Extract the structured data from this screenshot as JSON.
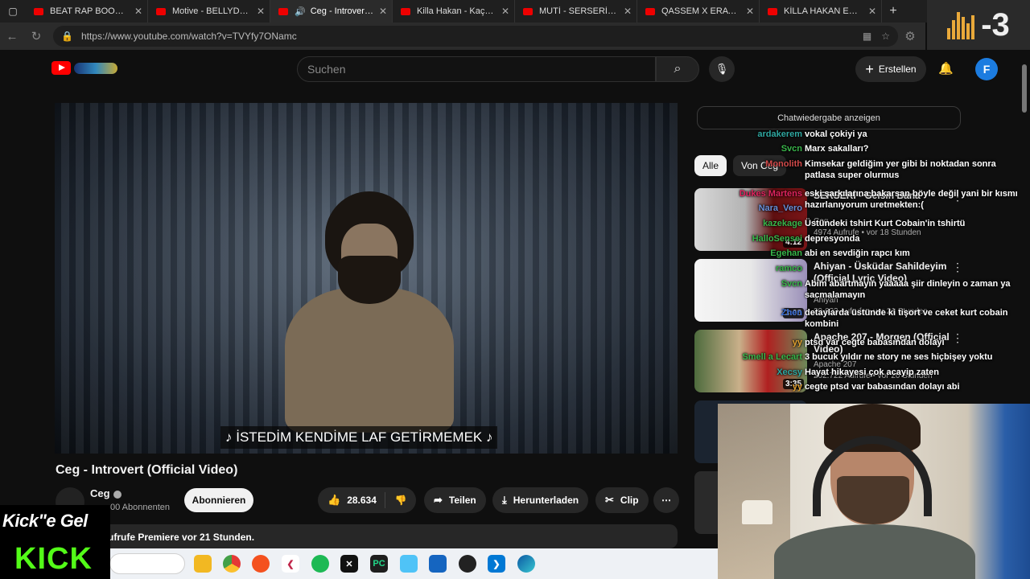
{
  "browser": {
    "tabs": [
      {
        "title": "BEAT RAP BOOM BAP",
        "active": false
      },
      {
        "title": "Motive - BELLYDANCE",
        "active": false
      },
      {
        "title": "Ceg - Introvert (O",
        "active": true
      },
      {
        "title": "Killa Hakan - Kaçan Ku",
        "active": false
      },
      {
        "title": "MUTİ - SERSERİ GÜNL",
        "active": false
      },
      {
        "title": "QASSEM X ERAY067 &",
        "active": false
      },
      {
        "title": "KİLLA HAKAN EV ZİYAR",
        "active": false
      }
    ],
    "url": "https://www.youtube.com/watch?v=TVYfy7ONamc"
  },
  "overlay_counter": "-3",
  "youtube": {
    "search_placeholder": "Suchen",
    "create_label": "Erstellen",
    "avatar_letter": "F",
    "video": {
      "subtitle": "♪ İSTEDİM KENDİME LAF GETİRMEMEK ♪",
      "title": "Ceg - Introvert (Official Video)",
      "channel": "Ceg",
      "subscribers": "00 Abonnenten",
      "subscribe_label": "Abonnieren",
      "likes": "28.634",
      "share_label": "Teilen",
      "download_label": "Herunterladen",
      "clip_label": "Clip",
      "description": "ufrufe  Premiere vor 21 Stunden."
    },
    "chat_header": "Chatwiedergabe anzeigen",
    "chips": [
      "Alle",
      "Von Ceg"
    ],
    "recommendations": [
      {
        "title": "SERSERİ - Gelsin Bana",
        "channel": "Ceg",
        "stats": "4974 Aufrufe • vor 18 Stunden",
        "badge": "Neu",
        "duration": "4:12"
      },
      {
        "title": "Ahiyan - Üsküdar Sahildeyim (Official Lyric Video)",
        "channel": "Ahiyan",
        "stats": "29.623 Aufrufe • vor 21 Stunden",
        "badge": "Neu",
        "duration": "3:08"
      },
      {
        "title": "Apache 207 - Morgen (Official Video)",
        "channel": "Apache 207",
        "stats": "202.722 Aufrufe • vor 20 Stunden",
        "badge": "",
        "duration": "3:35"
      }
    ]
  },
  "chat_messages": [
    {
      "user": "ardakerem",
      "text": "vokal çokiyi ya",
      "color": "#2fa7a0"
    },
    {
      "user": "Svcn",
      "text": "Marx sakalları?",
      "color": "#39b54a"
    },
    {
      "user": "Monolith",
      "text": "Kimsekar geldiğim yer gibi bi noktadan sonra patlasa super olurmus",
      "color": "#d24a4a"
    },
    {
      "user": "Dukes Martens",
      "text": "eski şarkılarına bakarsan böyle değil yani bir kısmı hazırlanıyorum uretmekten:(",
      "color": "#e0245e"
    },
    {
      "user": "Nara_Vero",
      "text": "",
      "color": "#6a8fd8"
    },
    {
      "user": "kazekage",
      "text": "Üstündeki tshirt Kurt Cobain'in tshirtü",
      "color": "#39b54a"
    },
    {
      "user": "HalloSensei",
      "text": "depresyonda",
      "color": "#39b54a"
    },
    {
      "user": "Egehan",
      "text": "abi en sevdiğin rapcı kım",
      "color": "#39b54a"
    },
    {
      "user": "ramco",
      "text": "",
      "color": "#39b54a"
    },
    {
      "user": "Svcn",
      "text": "Abim abartmayın yaaaaa şiir dinleyin o zaman ya sacmalamayın",
      "color": "#39b54a"
    },
    {
      "user": "Zhen",
      "text": "detaylarda üstünde ki tişort ve ceket kurt cobain kombini",
      "color": "#3b6fd8"
    },
    {
      "user": "yy",
      "text": "ptsd var cegte babasından dolayı",
      "color": "#e0a030"
    },
    {
      "user": "Smell a Lecart",
      "text": "3 bucuk yıldır ne story ne ses hiçbişey yoktu",
      "color": "#39b54a"
    },
    {
      "user": "Xecsy",
      "text": "Hayat hikayesi çok acayip zaten",
      "color": "#2fa7a0"
    },
    {
      "user": "yy",
      "text": "cegte ptsd var babasından dolayı abi",
      "color": "#e0a030"
    }
  ],
  "kick": {
    "line1": "Kick\"e Gel",
    "line2": "KICK"
  },
  "taskbar_icons": [
    "files",
    "chrome",
    "brave",
    "kali",
    "spotify",
    "capcut",
    "pycharm",
    "folder",
    "defender",
    "steam",
    "vscode",
    "edge"
  ]
}
